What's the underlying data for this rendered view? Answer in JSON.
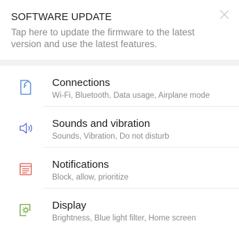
{
  "update_card": {
    "title": "SOFTWARE UPDATE",
    "description": "Tap here to update the firmware to the latest version and use the latest features."
  },
  "settings": [
    {
      "title": "Connections",
      "subtitle": "Wi-Fi, Bluetooth, Data usage, Airplane mode",
      "icon": "connections-icon",
      "color": "#4a7fd6"
    },
    {
      "title": "Sounds and vibration",
      "subtitle": "Sounds, Vibration, Do not disturb",
      "icon": "speaker-icon",
      "color": "#5b6fd1"
    },
    {
      "title": "Notifications",
      "subtitle": "Block, allow, prioritize",
      "icon": "notifications-icon",
      "color": "#e2584b"
    },
    {
      "title": "Display",
      "subtitle": "Brightness, Blue light filter, Home screen",
      "icon": "display-icon",
      "color": "#6aa33a"
    }
  ]
}
